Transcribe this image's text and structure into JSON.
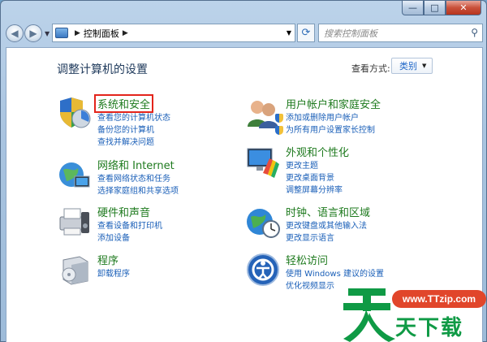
{
  "window": {
    "caption": {
      "minimize": "—",
      "maximize": "□",
      "close": "✕"
    }
  },
  "nav": {
    "back_icon": "back-arrow-icon",
    "forward_icon": "forward-arrow-icon",
    "address": {
      "path": "控制面板"
    },
    "search_placeholder": "搜索控制面板"
  },
  "page": {
    "title": "调整计算机的设置",
    "view_by_label": "查看方式:",
    "view_by_value": "类别"
  },
  "categories": [
    {
      "title": "系统和安全",
      "icon": "shield-computer-icon",
      "links": [
        "查看您的计算机状态",
        "备份您的计算机",
        "查找并解决问题"
      ]
    },
    {
      "title": "网络和 Internet",
      "icon": "network-globe-icon",
      "links": [
        "查看网络状态和任务",
        "选择家庭组和共享选项"
      ]
    },
    {
      "title": "硬件和声音",
      "icon": "printer-speaker-icon",
      "links": [
        "查看设备和打印机",
        "添加设备"
      ]
    },
    {
      "title": "程序",
      "icon": "program-box-icon",
      "links": [
        "卸载程序"
      ]
    },
    {
      "title": "用户帐户和家庭安全",
      "icon": "users-icon",
      "links": [
        "添加或删除用户帐户",
        "为所有用户设置家长控制"
      ]
    },
    {
      "title": "外观和个性化",
      "icon": "monitor-palette-icon",
      "links": [
        "更改主题",
        "更改桌面背景",
        "调整屏幕分辨率"
      ]
    },
    {
      "title": "时钟、语言和区域",
      "icon": "clock-globe-icon",
      "links": [
        "更改键盘或其他输入法",
        "更改显示语言"
      ]
    },
    {
      "title": "轻松访问",
      "icon": "ease-of-access-icon",
      "links": [
        "使用 Windows 建议的设置",
        "优化视频显示"
      ]
    }
  ],
  "watermark": {
    "url": "www.TTzip.com",
    "chars": "天下载"
  },
  "colors": {
    "category_title": "#1e7a1e",
    "link": "#1a5fb8",
    "highlight_box": "#e3241b"
  }
}
